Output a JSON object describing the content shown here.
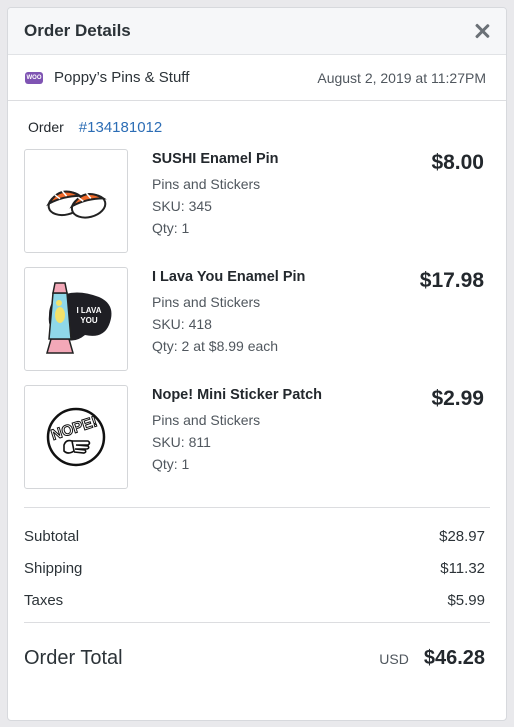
{
  "header": {
    "title": "Order Details"
  },
  "store": {
    "logo_text": "WOO",
    "name": "Poppy’s Pins & Stuff",
    "date": "August 2, 2019 at 11:27PM"
  },
  "order": {
    "label": "Order",
    "number": "#134181012"
  },
  "items": [
    {
      "name": "SUSHI Enamel Pin",
      "category": "Pins and Stickers",
      "sku": "SKU: 345",
      "qty": "Qty: 1",
      "price": "$8.00",
      "image_icon": "sushi-pin-icon"
    },
    {
      "name": "I Lava You Enamel Pin",
      "category": "Pins and Stickers",
      "sku": "SKU: 418",
      "qty": "Qty: 2 at $8.99 each",
      "price": "$17.98",
      "image_icon": "lava-lamp-pin-icon",
      "image_text_1": "I LAVA",
      "image_text_2": "YOU"
    },
    {
      "name": "Nope! Mini Sticker Patch",
      "category": "Pins and Stickers",
      "sku": "SKU: 811",
      "qty": "Qty: 1",
      "price": "$2.99",
      "image_icon": "nope-patch-icon",
      "image_text": "NOPE!"
    }
  ],
  "totals": {
    "subtotal_label": "Subtotal",
    "subtotal_value": "$28.97",
    "shipping_label": "Shipping",
    "shipping_value": "$11.32",
    "taxes_label": "Taxes",
    "taxes_value": "$5.99"
  },
  "grand_total": {
    "label": "Order Total",
    "currency": "USD",
    "value": "$46.28"
  },
  "colors": {
    "link": "#2c6db5",
    "woo_purple": "#7f54b3"
  }
}
